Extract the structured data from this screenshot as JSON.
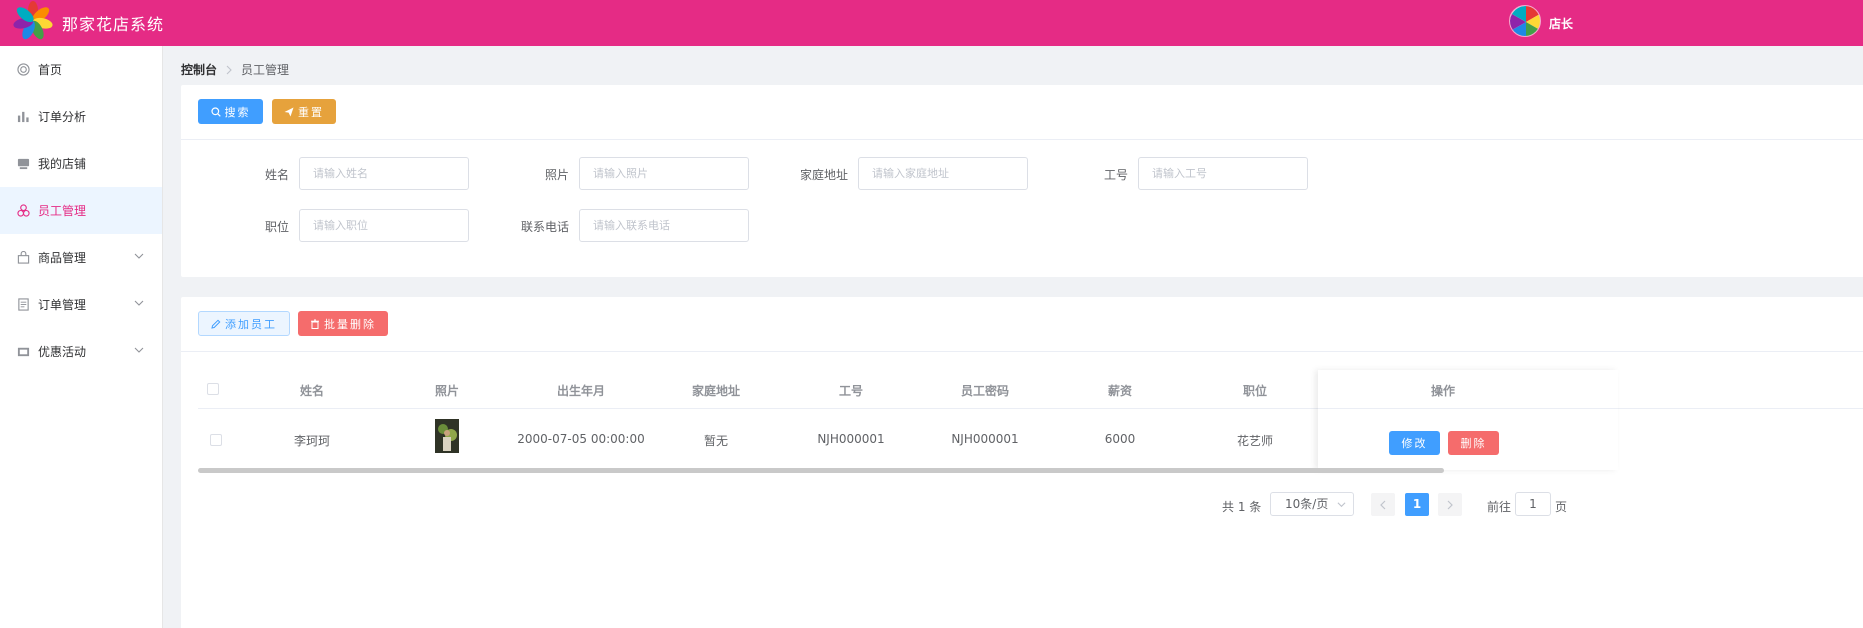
{
  "header": {
    "app_title": "那家花店系统",
    "user_name": "店长",
    "brand_color": "#e52b85"
  },
  "sidebar": {
    "items": [
      {
        "label": "首页",
        "icon": "home-icon"
      },
      {
        "label": "订单分析",
        "icon": "bar-chart-icon"
      },
      {
        "label": "我的店铺",
        "icon": "shop-icon"
      },
      {
        "label": "员工管理",
        "icon": "staff-icon",
        "active": true
      },
      {
        "label": "商品管理",
        "icon": "bag-icon",
        "expandable": true
      },
      {
        "label": "订单管理",
        "icon": "document-icon",
        "expandable": true
      },
      {
        "label": "优惠活动",
        "icon": "promotion-icon",
        "expandable": true
      }
    ]
  },
  "breadcrumb": {
    "home": "控制台",
    "current": "员工管理"
  },
  "search_card": {
    "search_label": "搜索",
    "reset_label": "重置",
    "fields": [
      {
        "label": "姓名",
        "placeholder": "请输入姓名"
      },
      {
        "label": "照片",
        "placeholder": "请输入照片"
      },
      {
        "label": "家庭地址",
        "placeholder": "请输入家庭地址"
      },
      {
        "label": "工号",
        "placeholder": "请输入工号"
      },
      {
        "label": "职位",
        "placeholder": "请输入职位"
      },
      {
        "label": "联系电话",
        "placeholder": "请输入联系电话"
      }
    ]
  },
  "table_card": {
    "add_label": "添加员工",
    "batch_delete_label": "批量删除",
    "columns": [
      "姓名",
      "照片",
      "出生年月",
      "家庭地址",
      "工号",
      "员工密码",
      "薪资",
      "职位",
      "操作"
    ],
    "rows": [
      {
        "name": "李珂珂",
        "birth": "2000-07-05 00:00:00",
        "address": "暂无",
        "employee_no": "NJH000001",
        "password": "NJH000001",
        "salary": "6000",
        "position": "花艺师"
      }
    ],
    "edit_label": "修改",
    "delete_label": "删除"
  },
  "pagination": {
    "total": "共 1 条",
    "page_size": "10条/页",
    "current_page": "1",
    "goto_label": "前往",
    "goto_value": "1",
    "page_suffix": "页"
  }
}
